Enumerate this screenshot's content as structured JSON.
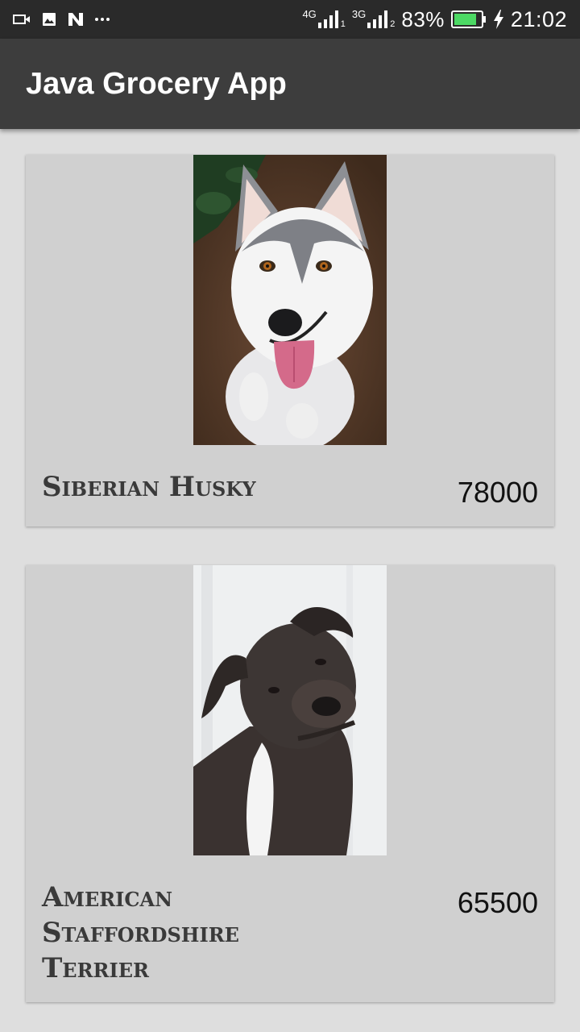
{
  "status_bar": {
    "network_1": "4G",
    "sim_1": "1",
    "network_2": "3G",
    "sim_2": "2",
    "battery_percent": "83%",
    "battery_level": 0.83,
    "time": "21:02",
    "icons": [
      "video-icon",
      "image-icon",
      "n-app-icon",
      "more-dots-icon",
      "signal-icon",
      "battery-icon",
      "charging-bolt-icon"
    ]
  },
  "app_bar": {
    "title": "Java Grocery App"
  },
  "products": [
    {
      "name": "Siberian Husky",
      "price": "78000"
    },
    {
      "name": "American Staffordshire Terrier",
      "price": "65500"
    }
  ],
  "colors": {
    "status_bar": "#2a2a2a",
    "app_bar": "#3d3d3d",
    "background": "#dedede",
    "card": "#d0d0d0",
    "battery_fill": "#4cd964"
  }
}
